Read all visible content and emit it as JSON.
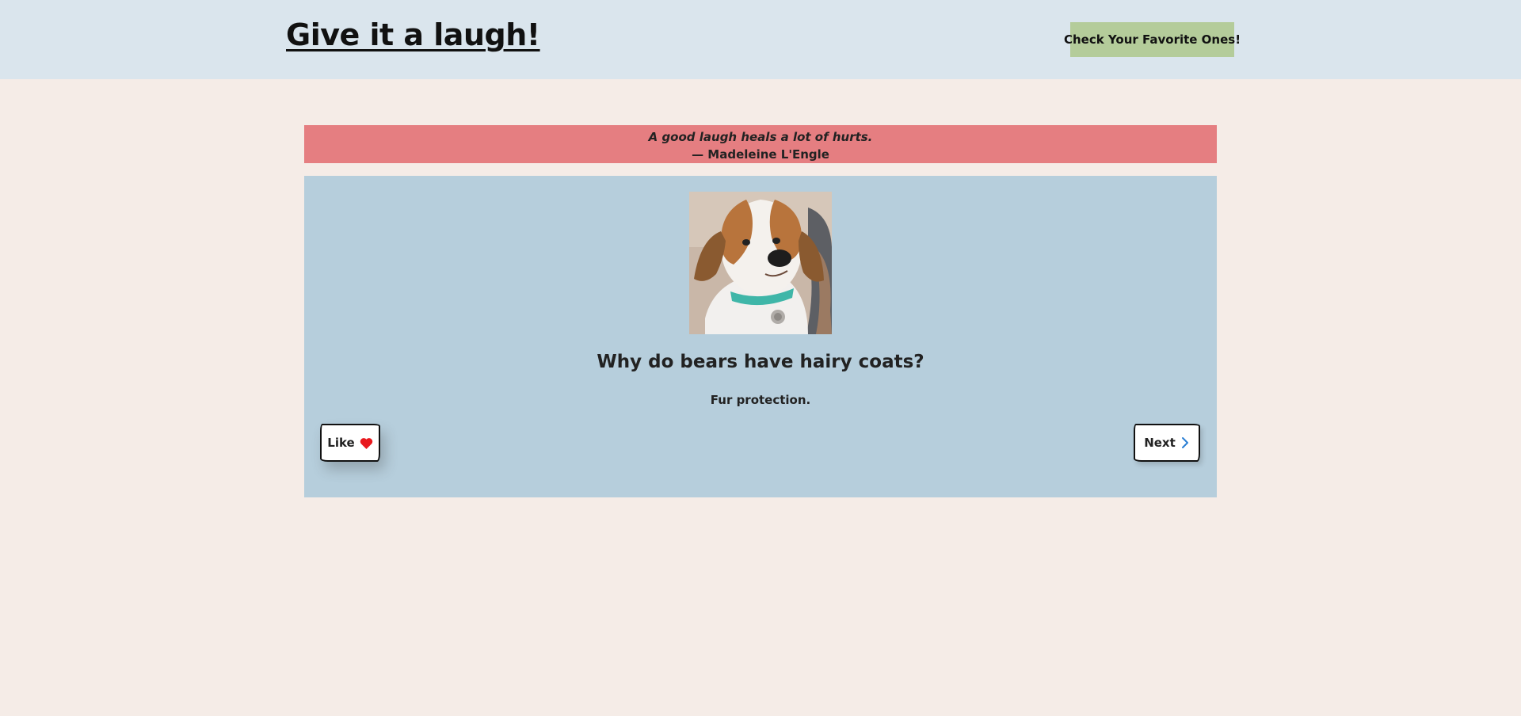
{
  "header": {
    "title": "Give it a laugh!",
    "favorites_button": "Check Your Favorite Ones!"
  },
  "quote": {
    "text": "A good laugh heals a lot of hurts.",
    "author": "— Madeleine L'Engle"
  },
  "joke": {
    "image_icon": "dog-photo",
    "question": "Why do bears have hairy coats?",
    "answer": "Fur protection."
  },
  "actions": {
    "like_label": "Like",
    "like_icon": "heart-icon",
    "next_label": "Next",
    "next_icon": "chevron-right-icon"
  },
  "colors": {
    "page_background": "#f5ece7",
    "header_background": "#dae5ed",
    "favorites_button": "#b4cc9a",
    "quote_banner": "#e57e81",
    "joke_card": "#b6cedc",
    "heart": "#e8181d",
    "chevron": "#2a7fd4"
  }
}
